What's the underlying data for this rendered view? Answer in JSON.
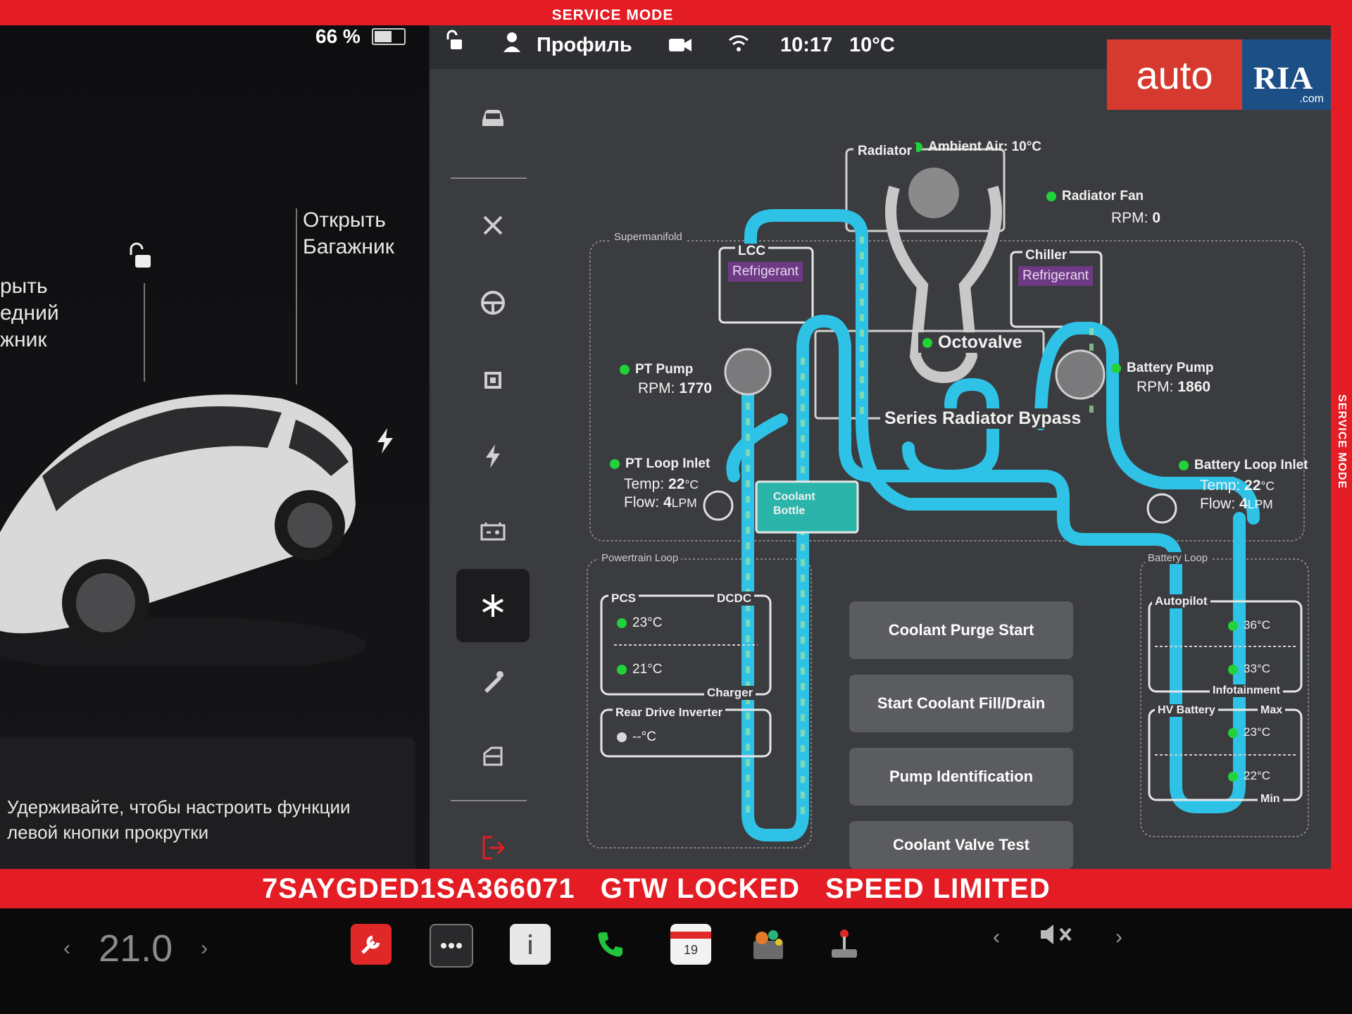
{
  "service": {
    "top_label": "SERVICE MODE",
    "side_label": "SERVICE MODE",
    "vin": "7SAYGDED1SA366071",
    "gtw_status": "GTW LOCKED",
    "speed_status": "SPEED LIMITED",
    "frame_color": "#e41c24"
  },
  "left_panel": {
    "battery_percent": "66 %",
    "battery_level": 0.66,
    "trunk_label_line1": "Открыть",
    "trunk_label_line2": "Багажник",
    "frunk_label_line1": "рыть",
    "frunk_label_line2": "едний",
    "frunk_label_line3": "жник",
    "hint_text": "Удерживайте, чтобы настроить функции левой кнопки прокрутки"
  },
  "status_bar": {
    "profile": "Профиль",
    "time": "10:17",
    "outside_temp": "10°C"
  },
  "watermark": {
    "auto": "auto",
    "ria": "RIA",
    "com": ".com"
  },
  "nav": [
    {
      "icon": "car-icon"
    },
    {
      "icon": "tools-icon"
    },
    {
      "icon": "steering-wheel-icon"
    },
    {
      "icon": "chip-icon"
    },
    {
      "icon": "bolt-icon"
    },
    {
      "icon": "battery-icon"
    },
    {
      "icon": "snowflake-icon",
      "active": true
    },
    {
      "icon": "wrench-pen-icon"
    },
    {
      "icon": "door-icon"
    },
    {
      "icon": "exit-icon"
    }
  ],
  "thermal": {
    "ambient": "Ambient Air: 10°C",
    "radiator": "Radiator",
    "radiator_fan": "Radiator Fan",
    "radiator_fan_rpm_label": "RPM:",
    "radiator_fan_rpm": "0",
    "supermanifold": "Supermanifold",
    "lcc": "LCC",
    "lcc_refrigerant": "Refrigerant",
    "chiller": "Chiller",
    "chiller_refrigerant": "Refrigerant",
    "octovalve": "Octovalve",
    "series_radiator_bypass": "Series Radiator Bypass",
    "pt_pump": "PT Pump",
    "pt_pump_rpm_label": "RPM:",
    "pt_pump_rpm": "1770",
    "battery_pump": "Battery Pump",
    "battery_pump_rpm_label": "RPM:",
    "battery_pump_rpm": "1860",
    "pt_loop_inlet": "PT Loop Inlet",
    "pt_temp_label": "Temp:",
    "pt_temp_value": "22",
    "pt_temp_unit": "°C",
    "pt_flow_label": "Flow:",
    "pt_flow_value": "4",
    "pt_flow_unit": "LPM",
    "coolant_bottle": "Coolant Bottle",
    "battery_loop_inlet": "Battery Loop Inlet",
    "bat_temp_label": "Temp:",
    "bat_temp_value": "22",
    "bat_temp_unit": "°C",
    "bat_flow_label": "Flow:",
    "bat_flow_value": "4",
    "bat_flow_unit": "LPM",
    "powertrain_loop": "Powertrain Loop",
    "pcs": "PCS",
    "dcdc": "DCDC",
    "pcs_temp": "23°C",
    "charger_temp": "21°C",
    "charger": "Charger",
    "rear_drive_inverter": "Rear Drive Inverter",
    "rdi_temp": "--°C",
    "battery_loop": "Battery Loop",
    "autopilot": "Autopilot",
    "autopilot_temp": "36°C",
    "infotainment_temp": "33°C",
    "infotainment": "Infotainment",
    "hv_battery": "HV Battery",
    "max": "Max",
    "hv_max_temp": "23°C",
    "hv_min_temp": "22°C",
    "min": "Min"
  },
  "buttons": {
    "coolant_purge": "Coolant Purge Start",
    "fill_drain": "Start Coolant Fill/Drain",
    "pump_id": "Pump Identification",
    "valve_test": "Coolant Valve Test"
  },
  "dock": {
    "cabin_temp": "21.0",
    "calendar_day": "19"
  }
}
